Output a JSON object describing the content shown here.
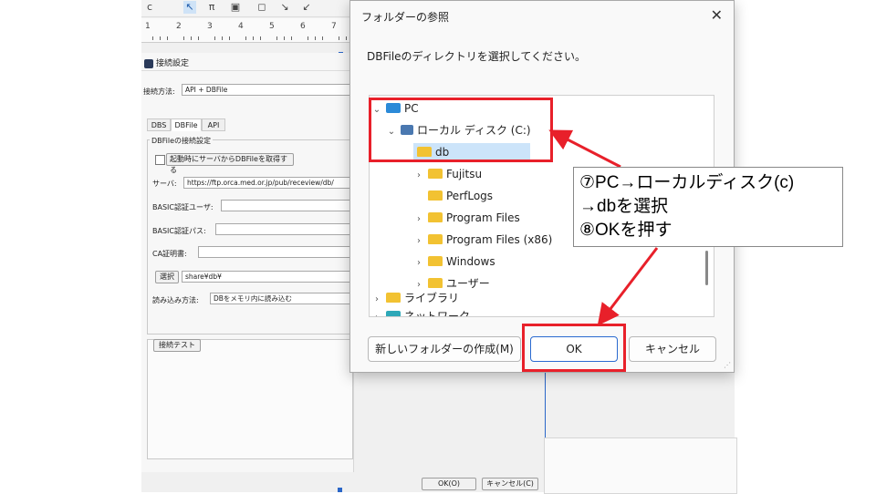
{
  "app": {
    "ruler_numbers": [
      "1",
      "2",
      "3",
      "4",
      "5",
      "6",
      "7"
    ]
  },
  "settings_panel": {
    "title": "接続設定",
    "method_label": "接続方法:",
    "method_value": "API + DBFile",
    "tabs": [
      "DBS",
      "DBFile",
      "API"
    ],
    "active_tab": "DBFile",
    "group_title": "DBFileの接続設定",
    "startup_checkbox_label": "起動時にサーバからDBFileを取得する",
    "server_label": "サーバ:",
    "server_value": "https://ftp.orca.med.or.jp/pub/receview/db/",
    "basic_user_label": "BASIC認証ユーザ:",
    "basic_pass_label": "BASIC認証パス:",
    "ca_label": "CA証明書:",
    "select_button": "選択",
    "select_path": "share¥db¥",
    "read_method_label": "読み込み方法:",
    "read_method_value": "DBをメモリ内に読み込む",
    "test_button": "接続テスト",
    "ok_button": "OK(O)",
    "cancel_button": "キャンセル(C)"
  },
  "dialog": {
    "title": "フォルダーの参照",
    "close_glyph": "✕",
    "message": "DBFileのディレクトリを選択してください。",
    "tree": [
      {
        "label": "PC",
        "icon": "pc-icon",
        "chevron": "✓",
        "level": 0
      },
      {
        "label": "ローカル ディスク (C:)",
        "icon": "disk-icon",
        "chevron": "✓",
        "level": 1
      },
      {
        "label": "db",
        "icon": "folder-icon",
        "chevron": "",
        "level": 2,
        "selected": true
      },
      {
        "label": "Fujitsu",
        "icon": "folder-icon",
        "chevron": ">",
        "level": 2
      },
      {
        "label": "PerfLogs",
        "icon": "folder-icon",
        "chevron": "",
        "level": 2
      },
      {
        "label": "Program Files",
        "icon": "folder-icon",
        "chevron": ">",
        "level": 2
      },
      {
        "label": "Program Files (x86)",
        "icon": "folder-icon",
        "chevron": ">",
        "level": 2
      },
      {
        "label": "Windows",
        "icon": "folder-icon",
        "chevron": ">",
        "level": 2
      },
      {
        "label": "ユーザー",
        "icon": "folder-icon",
        "chevron": ">",
        "level": 2
      },
      {
        "label": "ライブラリ",
        "icon": "library-icon",
        "chevron": ">",
        "level": 0
      },
      {
        "label": "ネットワーク",
        "icon": "network-icon",
        "chevron": ">",
        "level": 0
      }
    ],
    "new_folder_button": "新しいフォルダーの作成(M)",
    "ok_button": "OK",
    "cancel_button": "キャンセル"
  },
  "annotation": {
    "lines": [
      "⑦PC→ローカルディスク(c)",
      "→dbを選択",
      "⑧OKを押す"
    ],
    "color": "#e8202a"
  }
}
